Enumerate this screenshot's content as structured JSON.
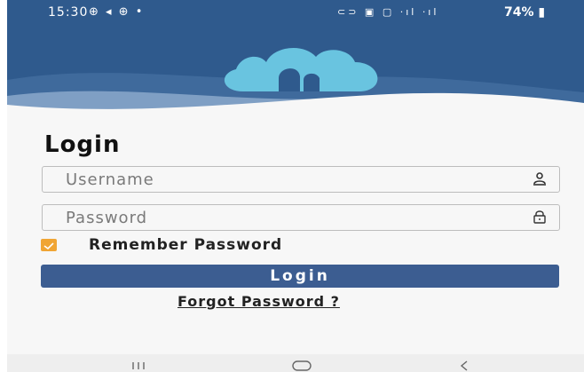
{
  "status_bar": {
    "time": "15:30",
    "left_icons": "⊕ ◂ ⊕ •",
    "right_icons": "⊂⊃ ▣ ▢ ·ıl ·ıl",
    "battery": "74%"
  },
  "header": {
    "logo_icon": "cloud-music-icon",
    "colors": {
      "background": "#2f5a8d",
      "logo": "#69c4e0"
    }
  },
  "form": {
    "title": "Login",
    "username": {
      "placeholder": "Username",
      "value": "",
      "icon": "user-icon"
    },
    "password": {
      "placeholder": "Password",
      "value": "",
      "icon": "lock-icon"
    },
    "remember": {
      "label": "Remember Password",
      "checked": true,
      "color": "#f0a534"
    },
    "login_button": "Login",
    "forgot_password": "Forgot Password ?"
  },
  "nav_bar": {
    "recents_icon": "recents-icon",
    "home_icon": "home-icon",
    "back_icon": "back-icon"
  }
}
